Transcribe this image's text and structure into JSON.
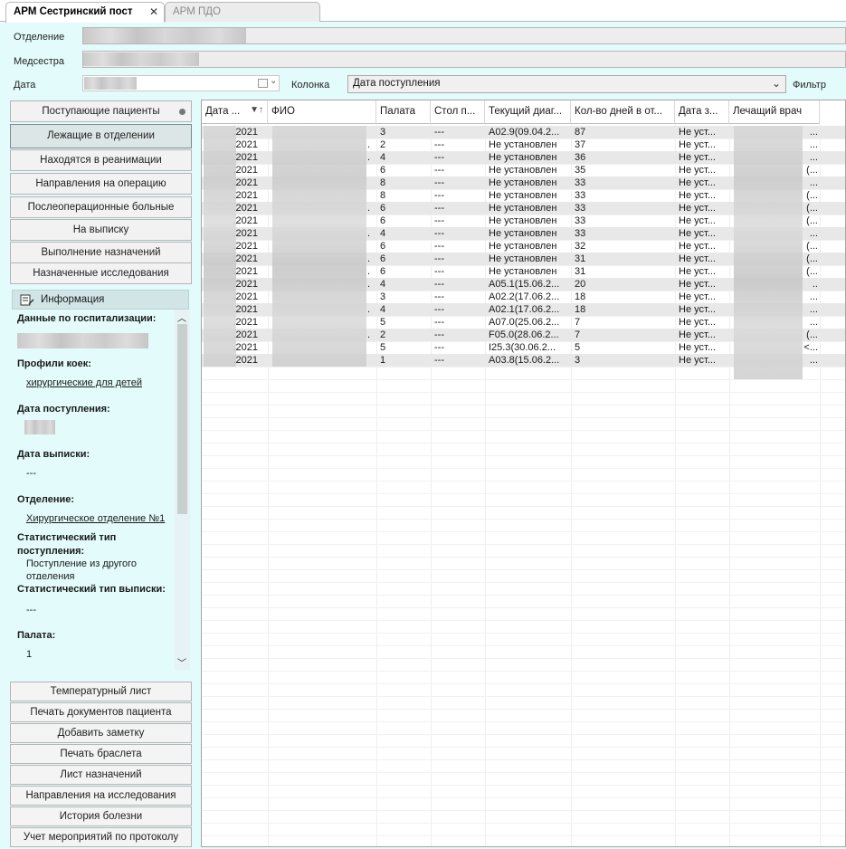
{
  "tabs": [
    {
      "label": "АРМ Сестринский пост",
      "close": "✕"
    },
    {
      "label": "АРМ ПДО"
    }
  ],
  "filters": {
    "department_label": "Отделение",
    "nurse_label": "Медсестра",
    "date_label": "Дата",
    "column_label": "Колонка",
    "column_value": "Дата поступления",
    "filter_label": "Фильтр"
  },
  "nav": [
    "Поступающие пациенты",
    "Лежащие в отделении",
    "Находятся в реанимации",
    "Направления на операцию",
    "Послеоперационные больные",
    "На выписку",
    "Выполнение назначений",
    "Назначенные исследования"
  ],
  "info": {
    "title": "Информация",
    "hosp_label": "Данные по госпитализации:",
    "bed_profile_label": "Профили коек:",
    "bed_profile_value": "хирургические для детей",
    "admit_date_label": "Дата поступления:",
    "discharge_date_label": "Дата выписки:",
    "discharge_date_value": "---",
    "department_label": "Отделение:",
    "department_value": "Хирургическое отделение №1",
    "stat_admit_label_1": "Статистический тип",
    "stat_admit_label_2": "поступления:",
    "stat_admit_value_1": "Поступление из другого",
    "stat_admit_value_2": "отделения",
    "stat_discharge_label": "Статистический тип выписки:",
    "stat_discharge_value": "---",
    "ward_label": "Палата:",
    "ward_value": "1"
  },
  "actions": [
    "Температурный лист",
    "Печать документов пациента",
    "Добавить заметку",
    "Печать браслета",
    "Лист назначений",
    "Направления на исследования",
    "История болезни",
    "Учет мероприятий по протоколу"
  ],
  "table": {
    "columns": [
      "Дата ...",
      "ФИО",
      "Палата",
      "Стол п...",
      "Текущий диаг...",
      "Кол-во дней в от...",
      "Дата з...",
      "Лечащий врач"
    ],
    "rows": [
      [
        ".2021",
        "",
        "3",
        "---",
        "A02.9(09.04.2...",
        "87",
        "Не уст...",
        "..."
      ],
      [
        ".2021",
        ".",
        "2",
        "---",
        "Не установлен",
        "37",
        "Не уст...",
        "..."
      ],
      [
        ".2021",
        ".",
        "4",
        "---",
        "Не установлен",
        "36",
        "Не уст...",
        "..."
      ],
      [
        ".2021",
        "",
        "6",
        "---",
        "Не установлен",
        "35",
        "Не уст...",
        "(..."
      ],
      [
        ".2021",
        "",
        "8",
        "---",
        "Не установлен",
        "33",
        "Не уст...",
        "..."
      ],
      [
        ".2021",
        "",
        "8",
        "---",
        "Не установлен",
        "33",
        "Не уст...",
        "(..."
      ],
      [
        ".2021",
        ".",
        "6",
        "---",
        "Не установлен",
        "33",
        "Не уст...",
        "(..."
      ],
      [
        ".2021",
        "",
        "6",
        "---",
        "Не установлен",
        "33",
        "Не уст...",
        "(..."
      ],
      [
        ".2021",
        ".",
        "4",
        "---",
        "Не установлен",
        "33",
        "Не уст...",
        "..."
      ],
      [
        ".2021",
        "",
        "6",
        "---",
        "Не установлен",
        "32",
        "Не уст...",
        "(..."
      ],
      [
        ".2021",
        ".",
        "6",
        "---",
        "Не установлен",
        "31",
        "Не уст...",
        "(..."
      ],
      [
        ".2021",
        ".",
        "6",
        "---",
        "Не установлен",
        "31",
        "Не уст...",
        "(..."
      ],
      [
        ".2021",
        ".",
        "4",
        "---",
        "A05.1(15.06.2...",
        "20",
        "Не уст...",
        ".."
      ],
      [
        ".2021",
        "",
        "3",
        "---",
        "A02.2(17.06.2...",
        "18",
        "Не уст...",
        "..."
      ],
      [
        ".2021",
        ".",
        "4",
        "---",
        "A02.1(17.06.2...",
        "18",
        "Не уст...",
        "..."
      ],
      [
        ".2021",
        "",
        "5",
        "---",
        "A07.0(25.06.2...",
        "7",
        "Не уст...",
        "..."
      ],
      [
        ".2021",
        ".",
        "2",
        "---",
        "F05.0(28.06.2...",
        "7",
        "Не уст...",
        "(..."
      ],
      [
        ".2021",
        "",
        "5",
        "---",
        "I25.3(30.06.2...",
        "5",
        "Не уст...",
        "<..."
      ],
      [
        ".2021",
        "",
        "1",
        "---",
        "A03.8(15.06.2...",
        "3",
        "Не уст...",
        "..."
      ]
    ]
  }
}
